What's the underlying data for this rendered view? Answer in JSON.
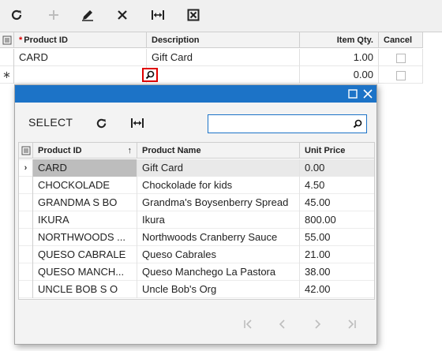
{
  "toolbar": {
    "icons": [
      "refresh-icon",
      "add-icon",
      "edit-icon",
      "delete-icon",
      "fit-columns-icon",
      "export-icon"
    ]
  },
  "grid": {
    "headers": {
      "product_id": "Product ID",
      "description": "Description",
      "item_qty": "Item Qty.",
      "cancel": "Cancel"
    },
    "required_marker": "*",
    "rows": [
      {
        "product_id": "CARD",
        "description": "Gift Card",
        "item_qty": "1.00",
        "cancel": false
      },
      {
        "product_id": "",
        "description": "",
        "item_qty": "0.00",
        "cancel": false
      }
    ],
    "new_row_marker": "∗"
  },
  "popup": {
    "select_label": "SELECT",
    "search_value": "",
    "headers": {
      "product_id": "Product ID",
      "product_name": "Product Name",
      "unit_price": "Unit Price"
    },
    "sort_indicator": "↑",
    "selected_marker": "›",
    "rows": [
      {
        "product_id": "CARD",
        "product_name": "Gift Card",
        "unit_price": "0.00"
      },
      {
        "product_id": "CHOCKOLADE",
        "product_name": "Chockolade for kids",
        "unit_price": "4.50"
      },
      {
        "product_id": "GRANDMA S BO",
        "product_name": "Grandma's Boysenberry Spread",
        "unit_price": "45.00"
      },
      {
        "product_id": "IKURA",
        "product_name": "Ikura",
        "unit_price": "800.00"
      },
      {
        "product_id": "NORTHWOODS ...",
        "product_name": "Northwoods Cranberry Sauce",
        "unit_price": "55.00"
      },
      {
        "product_id": "QUESO CABRALE",
        "product_name": "Queso Cabrales",
        "unit_price": "21.00"
      },
      {
        "product_id": "QUESO MANCH...",
        "product_name": "Queso Manchego La Pastora",
        "unit_price": "38.00"
      },
      {
        "product_id": "UNCLE BOB S O",
        "product_name": "Uncle Bob's Org",
        "unit_price": "42.00"
      }
    ]
  },
  "colors": {
    "title_bar": "#1c73c7",
    "required": "#dd0000",
    "lookup_highlight": "#e00000"
  }
}
